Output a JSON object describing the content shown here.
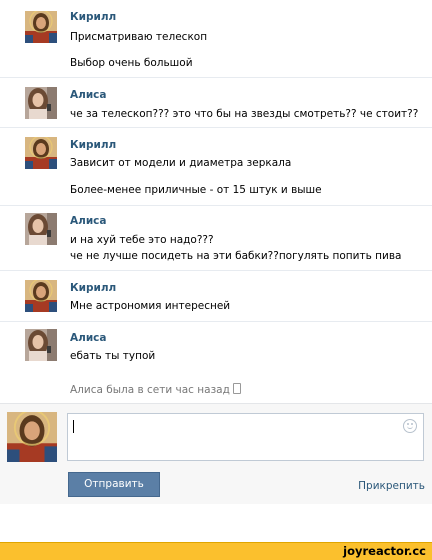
{
  "messages": [
    {
      "author": "Кирилл",
      "lines": [
        "Присматриваю телескоп",
        "Выбор очень большой"
      ]
    },
    {
      "author": "Алиса",
      "lines": [
        "че за телескоп??? это что бы на звезды смотреть?? че стоит??"
      ]
    },
    {
      "author": "Кирилл",
      "lines": [
        "Зависит от модели и диаметра зеркала",
        "Более-менее приличные - от 15 штук и выше"
      ]
    },
    {
      "author": "Алиса",
      "lines": [
        "и на хуй тебе это надо???",
        "че не лучше посидеть на эти бабки??погулять попить пива"
      ]
    },
    {
      "author": "Кирилл",
      "lines": [
        "Мне астрономия интересней"
      ]
    },
    {
      "author": "Алиса",
      "lines": [
        "ебать ты тупой"
      ]
    }
  ],
  "status": {
    "text": "Алиса была в сети час назад",
    "icon": "mobile-phone-icon"
  },
  "composer": {
    "send_label": "Отправить",
    "attach_label": "Прикрепить",
    "emoji_icon": "smile-icon"
  },
  "footer": {
    "watermark": "joyreactor.cc"
  },
  "colors": {
    "name": "#2b587a",
    "button": "#5b7fa6",
    "footer": "#fbc02d"
  }
}
